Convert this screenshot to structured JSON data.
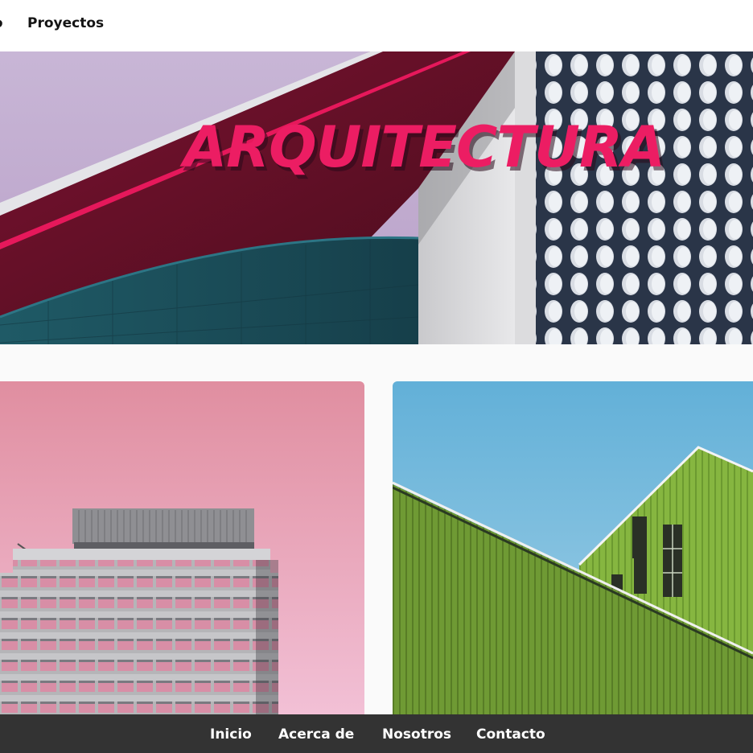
{
  "nav": {
    "items": [
      {
        "label": "io"
      },
      {
        "label": "Proyectos"
      }
    ]
  },
  "hero": {
    "title": "ARQUITECTURA"
  },
  "cards": [
    {
      "image": "pink-building-photo"
    },
    {
      "image": "green-building-photo"
    }
  ],
  "footer": {
    "links": [
      {
        "label": "Inicio"
      },
      {
        "label": "Acerca de"
      },
      {
        "label": "Nosotros"
      },
      {
        "label": "Contacto"
      }
    ]
  },
  "colors": {
    "accent": "#ec1d63",
    "footer_bg": "#333333",
    "nav_bg": "#ffffff",
    "page_bg": "#fafafa"
  }
}
